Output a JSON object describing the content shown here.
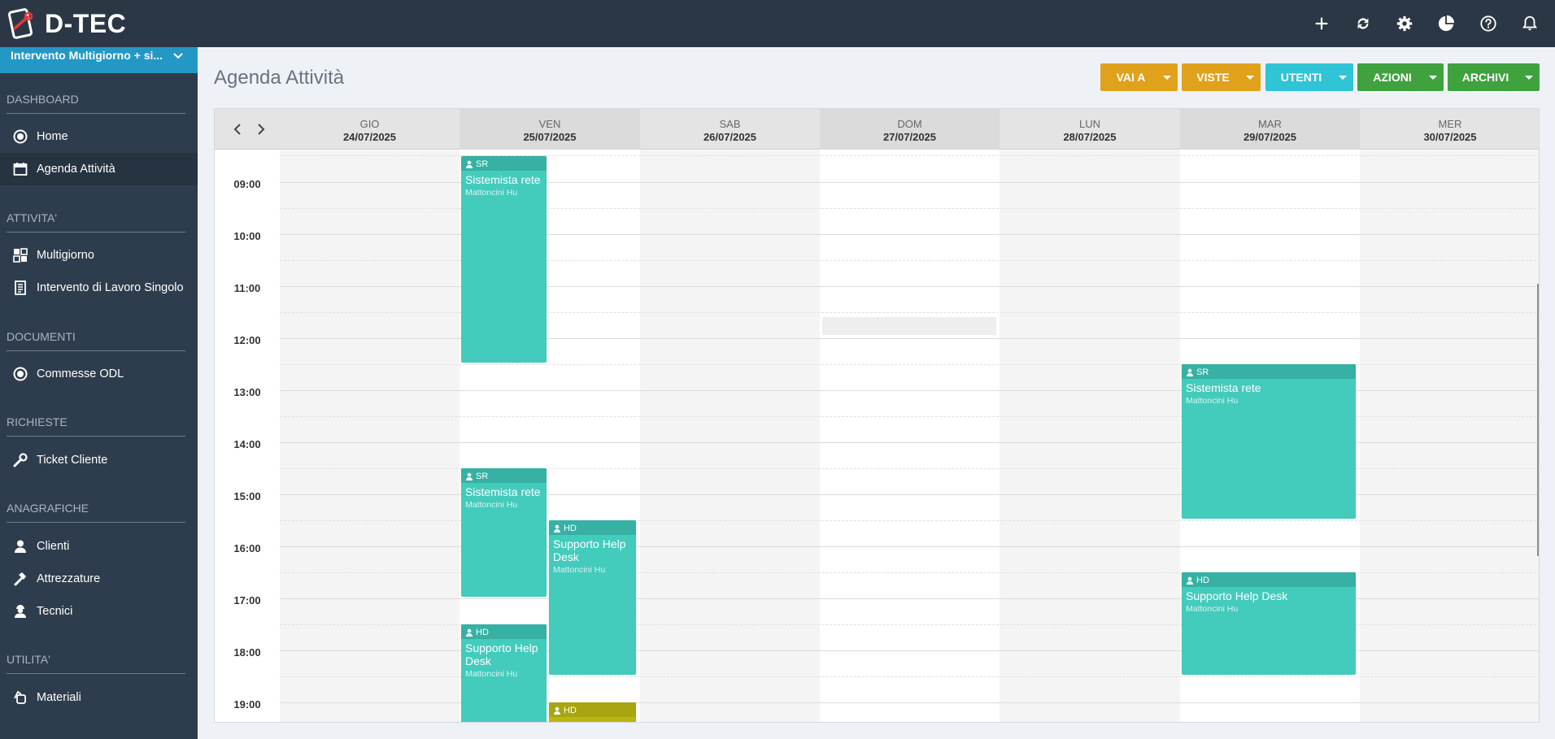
{
  "app": {
    "brand": "D-TEC"
  },
  "topbar": {
    "icons": [
      "add-icon",
      "sync-icon",
      "settings-icon",
      "pie-chart-icon",
      "help-icon",
      "bell-icon"
    ]
  },
  "sidebar": {
    "project": "Intervento Multigiorno + si...",
    "sections": {
      "dashboard": "DASHBOARD",
      "attivita": "ATTIVITA'",
      "documenti": "DOCUMENTI",
      "richieste": "RICHIESTE",
      "anagrafiche": "ANAGRAFICHE",
      "utilita": "UTILITA'"
    },
    "items": {
      "home": "Home",
      "agenda": "Agenda Attività",
      "multigiorno": "Multigiorno",
      "intervento": "Intervento di Lavoro Singolo",
      "commesse": "Commesse ODL",
      "ticket": "Ticket Cliente",
      "clienti": "Clienti",
      "attrezzature": "Attrezzature",
      "tecnici": "Tecnici",
      "materiali": "Materiali"
    }
  },
  "page": {
    "title": "Agenda Attività"
  },
  "toolbar": {
    "vai_a": "VAI A",
    "viste": "VISTE",
    "utenti": "UTENTI",
    "azioni": "AZIONI",
    "archivi": "ARCHIVI",
    "colors": {
      "vai_a": "#e0a21a",
      "viste": "#e0a21a",
      "utenti": "#2fc4d6",
      "azioni": "#3fa23f",
      "archivi": "#3fa23f"
    }
  },
  "calendar": {
    "days": [
      {
        "dow": "GIO",
        "date": "24/07/2025"
      },
      {
        "dow": "VEN",
        "date": "25/07/2025"
      },
      {
        "dow": "SAB",
        "date": "26/07/2025"
      },
      {
        "dow": "DOM",
        "date": "27/07/2025"
      },
      {
        "dow": "LUN",
        "date": "28/07/2025"
      },
      {
        "dow": "MAR",
        "date": "29/07/2025"
      },
      {
        "dow": "MER",
        "date": "30/07/2025"
      }
    ],
    "times": [
      "09:00",
      "10:00",
      "11:00",
      "12:00",
      "13:00",
      "14:00",
      "15:00",
      "16:00",
      "17:00",
      "18:00",
      "19:00"
    ],
    "events": [
      {
        "code": "SR",
        "title": "Sistemista rete",
        "client": "Mattoncini Hu",
        "day": "25/07/2025"
      },
      {
        "code": "SR",
        "title": "Sistemista rete",
        "client": "Mattoncini Hu",
        "day": "25/07/2025"
      },
      {
        "code": "HD",
        "title": "Supporto Help Desk",
        "client": "Mattoncini Hu",
        "day": "25/07/2025"
      },
      {
        "code": "HD",
        "title": "Supporto Help Desk",
        "client": "Mattoncini Hu",
        "day": "25/07/2025"
      },
      {
        "code": "HD",
        "title": "",
        "client": "",
        "day": "25/07/2025"
      },
      {
        "code": "SR",
        "title": "Sistemista rete",
        "client": "Mattoncini Hu",
        "day": "29/07/2025"
      },
      {
        "code": "HD",
        "title": "Supporto Help Desk",
        "client": "Mattoncini Hu",
        "day": "29/07/2025"
      }
    ],
    "event_colors": {
      "teal": "#43cbbc",
      "olive": "#b9b614"
    }
  }
}
